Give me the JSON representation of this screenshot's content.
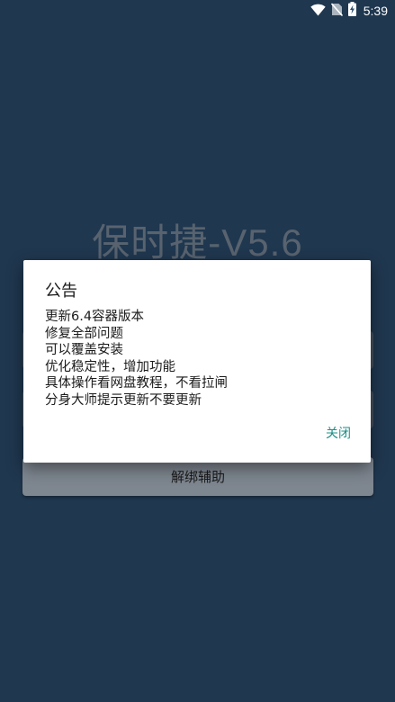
{
  "status_bar": {
    "time": "5:39",
    "icons": [
      "wifi-icon",
      "no-sim-icon",
      "battery-charging-icon"
    ]
  },
  "app": {
    "title": "保时捷-V5.6",
    "unbind_button_label": "解绑辅助"
  },
  "dialog": {
    "title": "公告",
    "lines": [
      "更新6.4容器版本",
      "修复全部问题",
      "可以覆盖安装",
      "优化稳定性，增加功能",
      "具体操作看网盘教程，不看拉闸",
      "分身大师提示更新不要更新"
    ],
    "close_label": "关闭"
  },
  "colors": {
    "background": "#2c4d6e",
    "dialog_bg": "#ffffff",
    "accent": "#1a8f86"
  }
}
